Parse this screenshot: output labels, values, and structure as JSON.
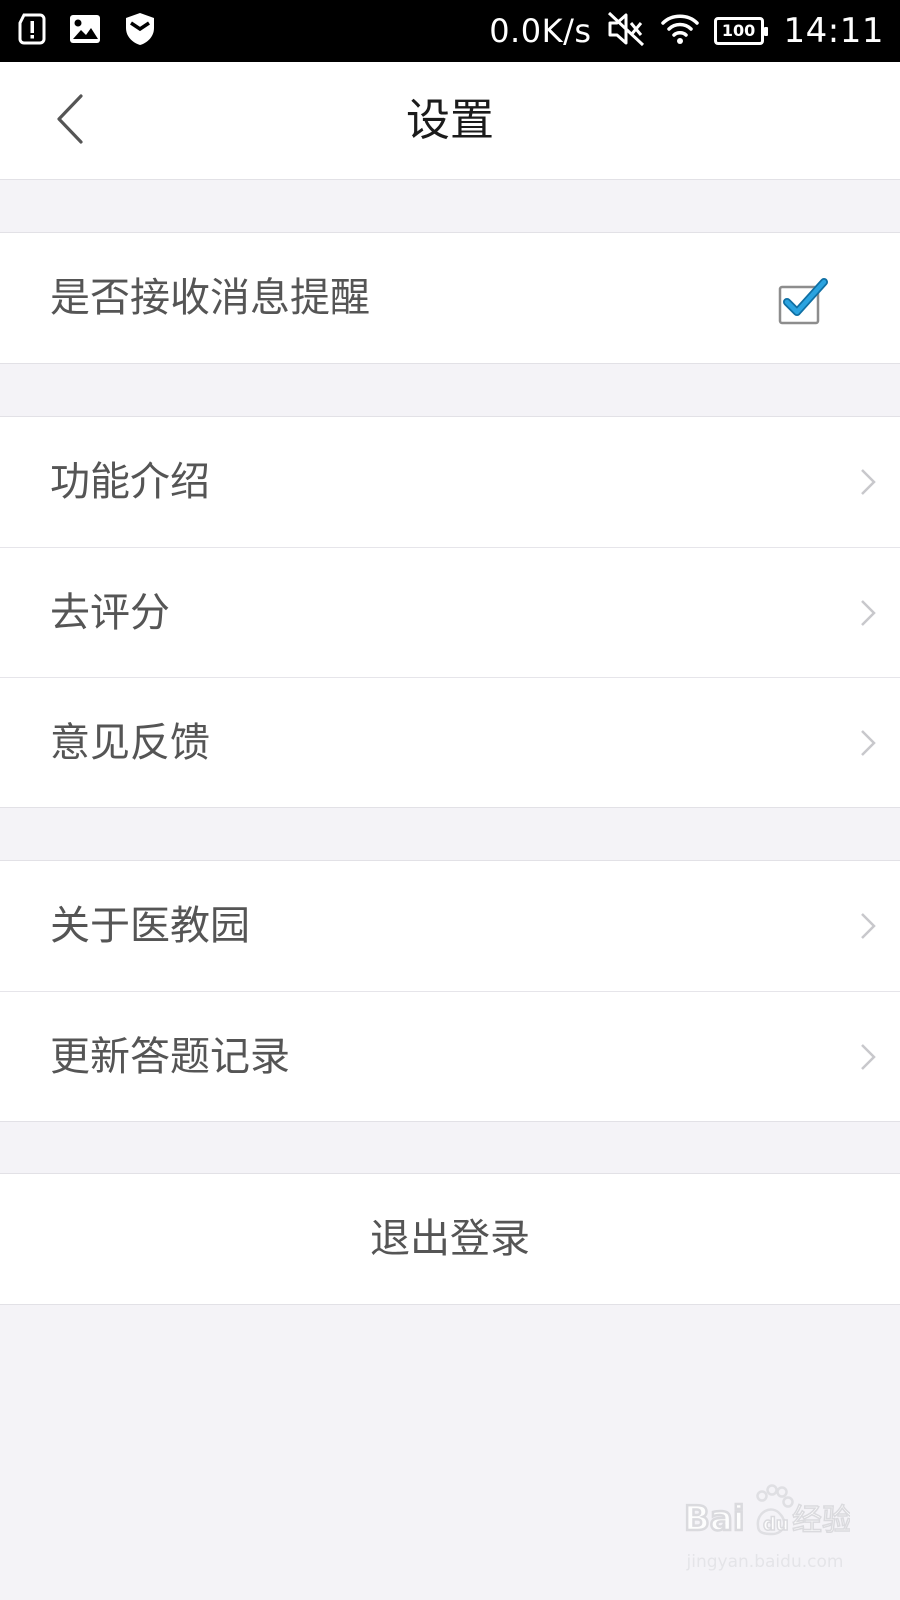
{
  "status_bar": {
    "net_speed": "0.0K/s",
    "battery_level": "100",
    "time": "14:11",
    "icons": [
      "alert-card-icon",
      "image-icon",
      "shield-icon",
      "mute-icon",
      "wifi-icon",
      "battery-icon"
    ]
  },
  "header": {
    "title": "设置",
    "back_icon": "chevron-left-icon"
  },
  "settings": {
    "notification": {
      "label": "是否接收消息提醒",
      "checked": true
    },
    "group_info": [
      {
        "label": "功能介绍"
      },
      {
        "label": "去评分"
      },
      {
        "label": "意见反馈"
      }
    ],
    "group_about": [
      {
        "label": "关于医教园"
      },
      {
        "label": "更新答题记录"
      }
    ],
    "logout": {
      "label": "退出登录"
    }
  },
  "watermark": {
    "url": "jingyan.baidu.com"
  },
  "colors": {
    "background": "#f4f3f7",
    "row_text": "#555555",
    "title_text": "#1b1b1b",
    "checkbox_check": "#1a8fd0",
    "chevron": "#c8c8cc"
  }
}
